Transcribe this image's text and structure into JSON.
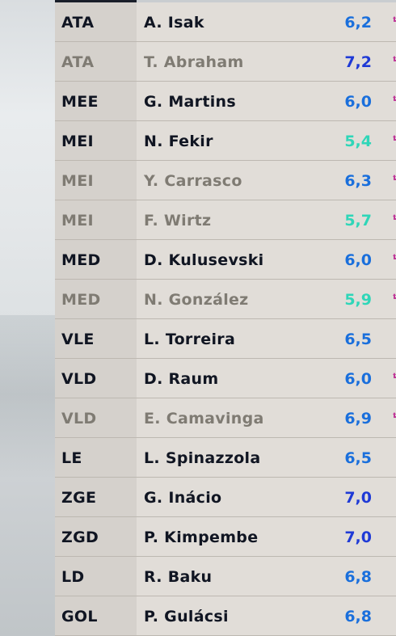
{
  "colors": {
    "rating_blue": "#1a6fdc",
    "rating_dark_blue": "#1f3ad6",
    "rating_teal": "#2fd6b8",
    "swap_arrow_pink": "#c0399a",
    "swap_arrow_teal": "#2ab3a4"
  },
  "players": [
    {
      "position": "ATA",
      "name": "A. Isak",
      "rating": "6,2",
      "active": true,
      "swap": true,
      "rating_color": "#1a6fdc"
    },
    {
      "position": "ATA",
      "name": "T. Abraham",
      "rating": "7,2",
      "active": false,
      "swap": true,
      "rating_color": "#1f3ad6"
    },
    {
      "position": "MEE",
      "name": "G. Martins",
      "rating": "6,0",
      "active": true,
      "swap": true,
      "rating_color": "#1a6fdc"
    },
    {
      "position": "MEI",
      "name": "N. Fekir",
      "rating": "5,4",
      "active": true,
      "swap": true,
      "rating_color": "#2fd6b8"
    },
    {
      "position": "MEI",
      "name": "Y. Carrasco",
      "rating": "6,3",
      "active": false,
      "swap": true,
      "rating_color": "#1a6fdc"
    },
    {
      "position": "MEI",
      "name": "F. Wirtz",
      "rating": "5,7",
      "active": false,
      "swap": true,
      "rating_color": "#2fd6b8"
    },
    {
      "position": "MED",
      "name": "D. Kulusevski",
      "rating": "6,0",
      "active": true,
      "swap": true,
      "rating_color": "#1a6fdc"
    },
    {
      "position": "MED",
      "name": "N. González",
      "rating": "5,9",
      "active": false,
      "swap": true,
      "rating_color": "#2fd6b8"
    },
    {
      "position": "VLE",
      "name": "L. Torreira",
      "rating": "6,5",
      "active": true,
      "swap": false,
      "rating_color": "#1a6fdc"
    },
    {
      "position": "VLD",
      "name": "D. Raum",
      "rating": "6,0",
      "active": true,
      "swap": true,
      "rating_color": "#1a6fdc"
    },
    {
      "position": "VLD",
      "name": "E. Camavinga",
      "rating": "6,9",
      "active": false,
      "swap": true,
      "rating_color": "#1a6fdc"
    },
    {
      "position": "LE",
      "name": "L. Spinazzola",
      "rating": "6,5",
      "active": true,
      "swap": false,
      "rating_color": "#1a6fdc"
    },
    {
      "position": "ZGE",
      "name": "G. Inácio",
      "rating": "7,0",
      "active": true,
      "swap": false,
      "rating_color": "#1f3ad6"
    },
    {
      "position": "ZGD",
      "name": "P. Kimpembe",
      "rating": "7,0",
      "active": true,
      "swap": false,
      "rating_color": "#1f3ad6"
    },
    {
      "position": "LD",
      "name": "R. Baku",
      "rating": "6,8",
      "active": true,
      "swap": false,
      "rating_color": "#1a6fdc"
    },
    {
      "position": "GOL",
      "name": "P. Gulácsi",
      "rating": "6,8",
      "active": true,
      "swap": false,
      "rating_color": "#1a6fdc"
    }
  ]
}
